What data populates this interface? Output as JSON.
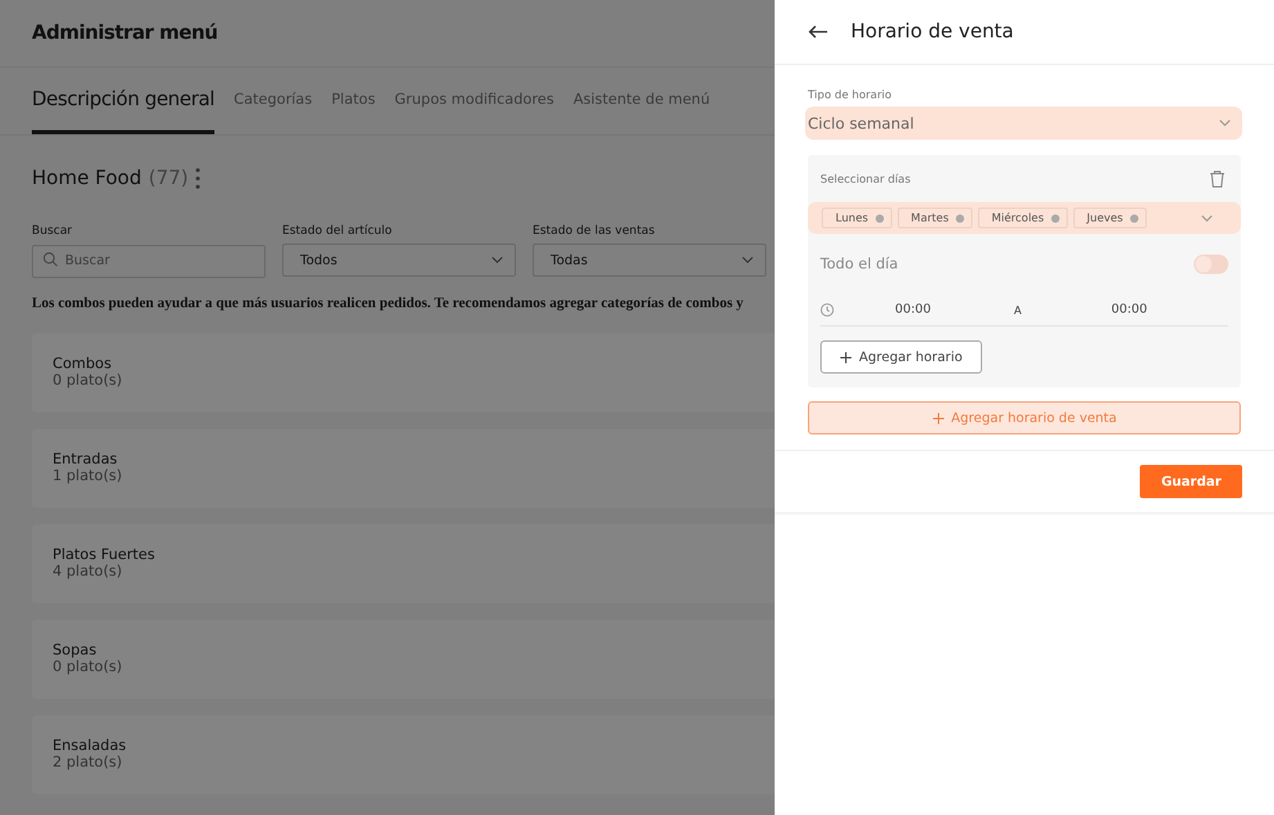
{
  "page": {
    "title": "Administrar menú",
    "tabs": [
      {
        "label": "Descripción general",
        "selected": true
      },
      {
        "label": "Categorías",
        "selected": false
      },
      {
        "label": "Platos",
        "selected": false
      },
      {
        "label": "Grupos modificadores",
        "selected": false
      },
      {
        "label": "Asistente de menú",
        "selected": false
      }
    ],
    "menu_name": "Home Food",
    "menu_count": "(77)",
    "filters": [
      {
        "kind": "search",
        "label": "Buscar",
        "placeholder": "Buscar"
      },
      {
        "kind": "select",
        "label": "Estado del artículo",
        "value": "Todos"
      },
      {
        "kind": "select",
        "label": "Estado de las ventas",
        "value": "Todas"
      }
    ],
    "notice": "Los combos pueden ayudar a que más usuarios realicen pedidos. Te recomendamos agregar categorías de combos y",
    "categories": [
      {
        "name": "Combos",
        "count": "0 plato(s)"
      },
      {
        "name": "Entradas",
        "count": "1 plato(s)"
      },
      {
        "name": "Platos Fuertes",
        "count": "4 plato(s)"
      },
      {
        "name": "Sopas",
        "count": "0 plato(s)"
      },
      {
        "name": "Ensaladas",
        "count": "2 plato(s)"
      }
    ]
  },
  "drawer": {
    "title": "Horario de venta",
    "schedule_type": {
      "label": "Tipo de horario",
      "value": "Ciclo semanal"
    },
    "schedule": {
      "days_label": "Seleccionar días",
      "days": [
        "Lunes",
        "Martes",
        "Miércoles",
        "Jueves"
      ],
      "all_day": {
        "label": "Todo el día",
        "on": false
      },
      "time_from": "00:00",
      "time_separator": "A",
      "time_to": "00:00",
      "add_time_button": "Agregar horario"
    },
    "add_schedule_button": "Agregar horario de venta",
    "save_button": "Guardar"
  }
}
